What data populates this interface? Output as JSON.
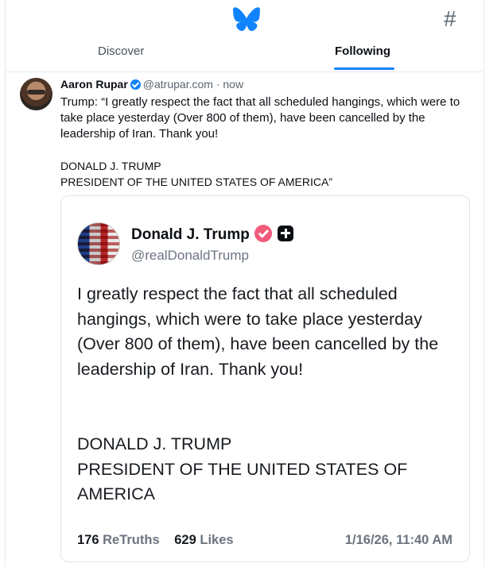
{
  "header": {
    "logo_icon": "bluesky-butterfly-icon",
    "feeds_icon": "hash-icon",
    "feeds_symbol": "#",
    "tabs": [
      {
        "label": "Discover",
        "active": false
      },
      {
        "label": "Following",
        "active": true
      }
    ],
    "accent_color": "#1083fe"
  },
  "post": {
    "author_name": "Aaron Rupar",
    "author_handle": "@atrupar.com",
    "separator": "·",
    "time": "now",
    "text_main": "Trump: “I greatly respect the fact that all scheduled hangings, which were to take place yesterday (Over 800 of them), have been cancelled by the leadership of Iran. Thank you!",
    "text_sign_1": "DONALD J. TRUMP",
    "text_sign_2": "PRESIDENT OF THE UNITED STATES OF AMERICA”",
    "embed": {
      "name": "Donald J. Trump",
      "handle": "@realDonaldTrump",
      "body": "I greatly respect the fact that all scheduled hangings, which were to take place yesterday (Over 800 of them), have been cancelled by the leadership of Iran. Thank you!",
      "sign_1": "DONALD J. TRUMP",
      "sign_2": "PRESIDENT OF THE UNITED STATES OF AMERICA",
      "retruths_count": "176",
      "retruths_label": "ReTruths",
      "likes_count": "629",
      "likes_label": "Likes",
      "date": "1/16/26, 11:40 AM"
    }
  }
}
